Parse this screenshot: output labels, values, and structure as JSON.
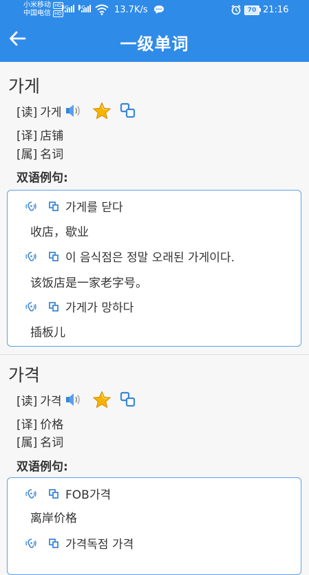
{
  "status_bar": {
    "carrier1": "小米移动",
    "carrier1_badge": "HD",
    "carrier2": "中国电信",
    "carrier2_badge": "HD",
    "net1": "4G",
    "net2": "4G",
    "speed": "13.7K/s",
    "battery": "70",
    "time": "21:16"
  },
  "header": {
    "title": "一级单词"
  },
  "words": [
    {
      "headword": "가게",
      "read_label": "[读]",
      "read_value": "가게",
      "trans_label": "[译]",
      "trans_value": "店铺",
      "pos_label": "[属]",
      "pos_value": "名词",
      "examples_title": "双语例句:",
      "examples": [
        {
          "kr": "가게를 닫다",
          "cn": "收店，歇业"
        },
        {
          "kr": "이 음식점은 정말 오래된 가게이다.",
          "cn": "该饭店是一家老字号。"
        },
        {
          "kr": "가게가 망하다",
          "cn": "插板儿"
        }
      ]
    },
    {
      "headword": "가격",
      "read_label": "[读]",
      "read_value": "가격",
      "trans_label": "[译]",
      "trans_value": "价格",
      "pos_label": "[属]",
      "pos_value": "名词",
      "examples_title": "双语例句:",
      "examples": [
        {
          "kr": "FOB가격",
          "cn": "离岸价格"
        },
        {
          "kr": "가격독점 가격",
          "cn": ""
        }
      ]
    }
  ],
  "colors": {
    "header": "#2f8be8",
    "example_border": "#5aa0e6",
    "icon_blue": "#3a86d6",
    "star": "#f6b400"
  },
  "icons": [
    "back-arrow-icon",
    "speaker-icon",
    "star-icon",
    "copy-icon",
    "ear-audio-icon",
    "link-copy-icon"
  ]
}
